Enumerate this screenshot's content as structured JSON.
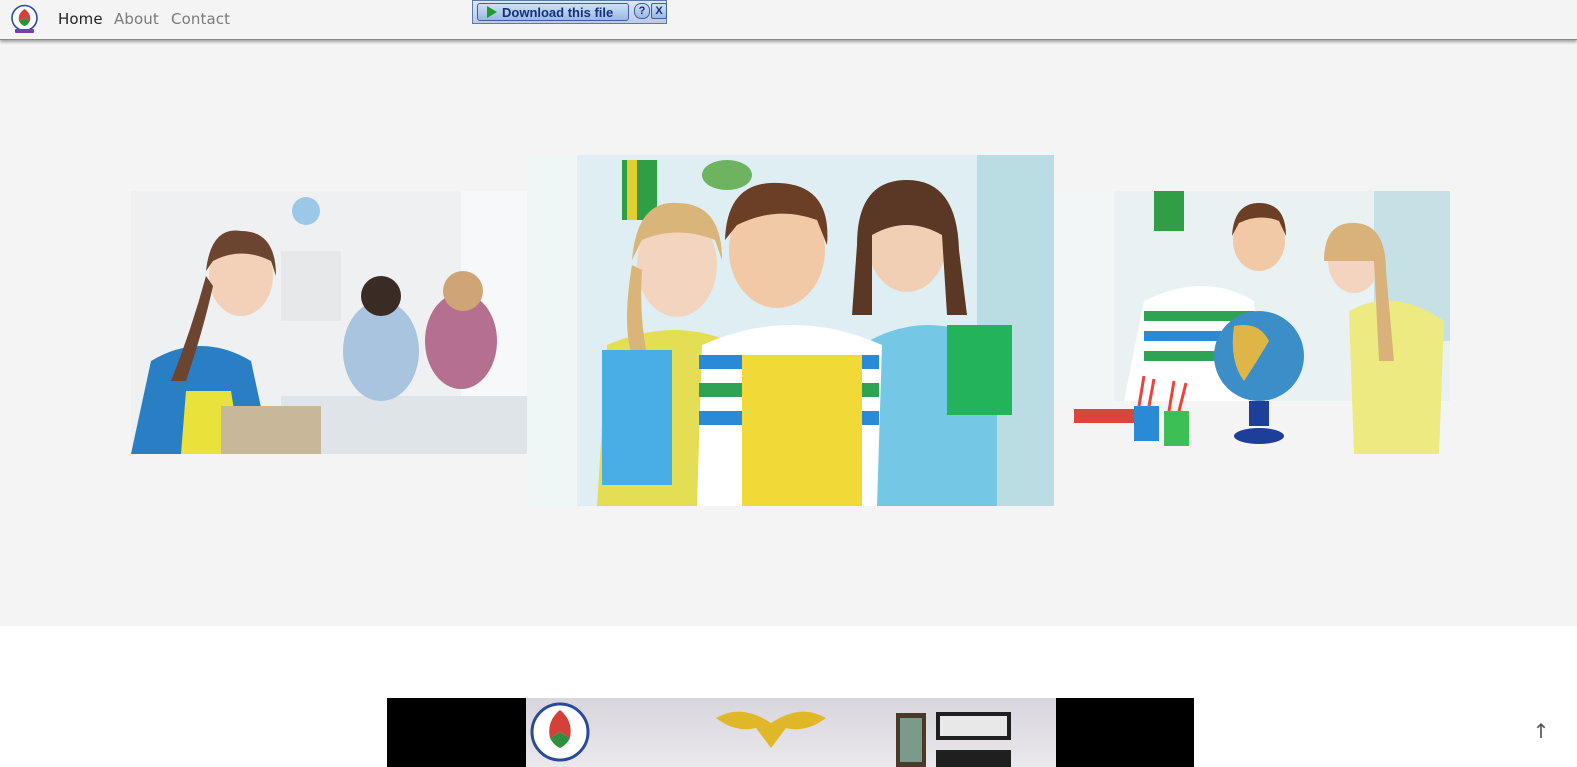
{
  "navbar": {
    "links": [
      {
        "label": "Home",
        "active": true
      },
      {
        "label": "About",
        "active": false
      },
      {
        "label": "Contact",
        "active": false
      }
    ]
  },
  "download_bar": {
    "button_label": "Download this file",
    "help_label": "?",
    "close_label": "X"
  },
  "carousel": {
    "slides": [
      "girl-with-backpack-classroom",
      "three-children-holding-books",
      "children-looking-at-globe"
    ]
  },
  "scroll_top": {
    "icon": "arrow-up-icon",
    "glyph": "↑"
  },
  "colors": {
    "hero_bg": "#f4f4f4",
    "nav_bg": "#f4f4f4",
    "video_bg": "#000000"
  }
}
